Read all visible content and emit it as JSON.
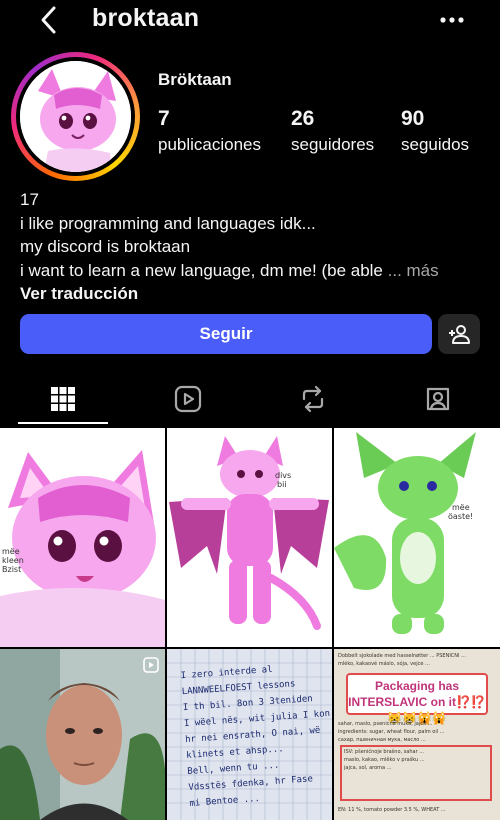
{
  "header": {
    "username": "broktaan",
    "back_icon": "chevron-left-icon",
    "more_icon": "more-horizontal-icon"
  },
  "profile": {
    "display_name": "Bröktaan",
    "avatar_caption": "mëe\nkleen\nBzist",
    "stats": [
      {
        "value": "7",
        "label": "publicaciones"
      },
      {
        "value": "26",
        "label": "seguidores"
      },
      {
        "value": "90",
        "label": "seguidos"
      }
    ],
    "bio_lines": [
      "17",
      "i like programming and languages idk...",
      "my discord is broktaan",
      "i want to learn a new language, dm me! (be able"
    ],
    "bio_more": "... más",
    "translate_label": "Ver traducción"
  },
  "actions": {
    "follow_label": "Seguir",
    "add_user_icon": "add-person-icon",
    "follow_color": "#4a5df9"
  },
  "tabs": [
    {
      "name": "posts-grid",
      "icon": "grid-icon",
      "active": true
    },
    {
      "name": "reels",
      "icon": "reels-icon",
      "active": false
    },
    {
      "name": "reposts",
      "icon": "repost-icon",
      "active": false
    },
    {
      "name": "tagged",
      "icon": "tagged-icon",
      "active": false
    }
  ],
  "grid_posts": [
    {
      "caption": "mëe\nkleen\nBzist"
    },
    {
      "caption": "divs\nbii"
    },
    {
      "caption": "mëe\nöaste!"
    },
    {
      "type": "reel"
    },
    {
      "note_lines": [
        "I zero interde al",
        "LANNWEELFOEST lessons",
        "I th bil. 8on 3 3teniden",
        "I wëel nës, wit julia I kon",
        "hr nei ensrath, O nai, wë",
        "klinets et ahsp...",
        "Bell, wenn tu ...",
        "Vdsstës fdenka, hr Fase",
        "mi Bentoe ..."
      ]
    },
    {
      "banner": "Packaging has INTERSLAVIC on it⁉️⁉️😸😸🙀🙀"
    }
  ]
}
